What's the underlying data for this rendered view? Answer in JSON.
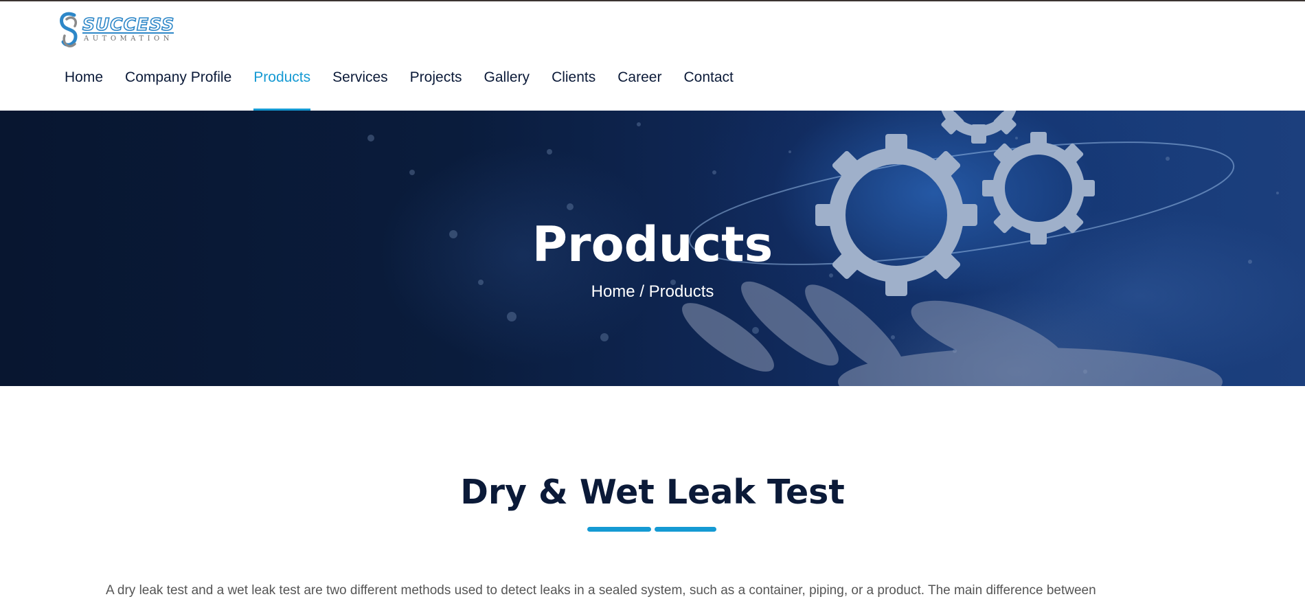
{
  "brand": {
    "name": "SUCCESS",
    "tagline": "AUTOMATION",
    "primary_color": "#159ad3",
    "dark_color": "#0b1a38"
  },
  "nav": {
    "items": [
      "Home",
      "Company Profile",
      "Products",
      "Services",
      "Projects",
      "Gallery",
      "Clients",
      "Career",
      "Contact"
    ],
    "active": "Products"
  },
  "hero": {
    "title": "Products",
    "breadcrumb": {
      "home": "Home",
      "separator": "/",
      "current": "Products"
    }
  },
  "section": {
    "title": "Dry & Wet Leak Test",
    "intro": "A dry leak test and a wet leak test are two different methods used to detect leaks in a sealed system, such as a container, piping, or a product. The main difference between"
  }
}
